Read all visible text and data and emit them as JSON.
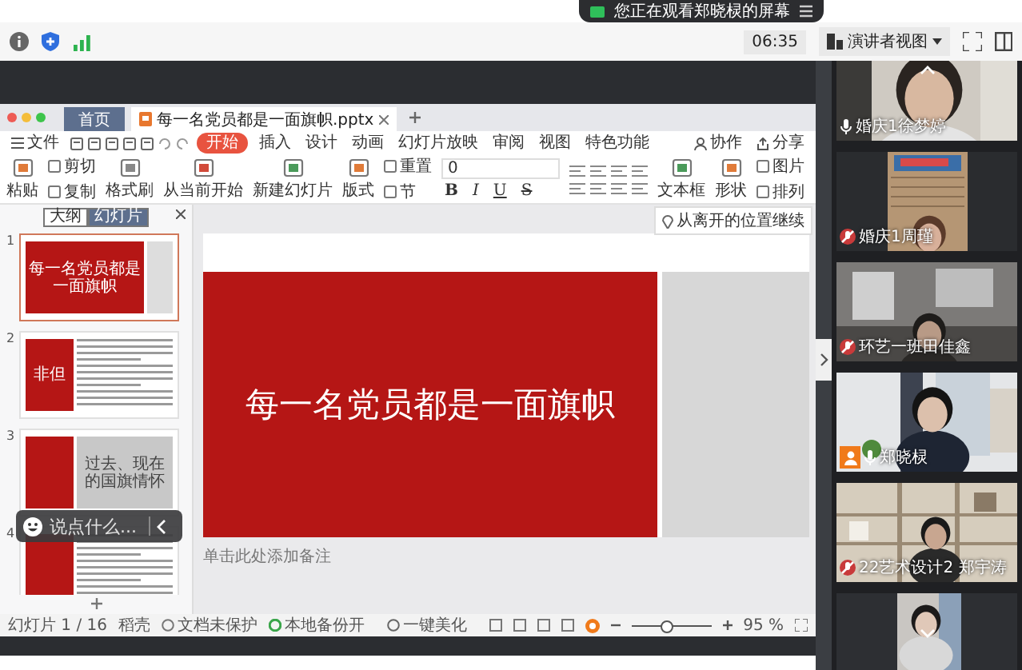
{
  "banner": {
    "text": "您正在观看郑晓棂的屏幕"
  },
  "toolbar": {
    "time": "06:35",
    "view_menu": "演讲者视图"
  },
  "presentation": {
    "tabs": [
      {
        "label": "首页",
        "kind": "home",
        "selected": false
      },
      {
        "label": "每一名党员都是一面旗帜.pptx",
        "kind": "document",
        "selected": true
      }
    ],
    "file_menu": "文件",
    "menu": [
      {
        "label": "开始",
        "selected": true
      },
      {
        "label": "插入",
        "selected": false
      },
      {
        "label": "设计",
        "selected": false
      },
      {
        "label": "动画",
        "selected": false
      },
      {
        "label": "幻灯片放映",
        "selected": false
      },
      {
        "label": "审阅",
        "selected": false
      },
      {
        "label": "视图",
        "selected": false
      },
      {
        "label": "特色功能",
        "selected": false
      }
    ],
    "share_actions": [
      "协作",
      "分享"
    ],
    "ribbon": [
      {
        "kind": "large",
        "label": "粘贴"
      },
      {
        "kind": "stack",
        "items": [
          "剪切",
          "复制"
        ]
      },
      {
        "kind": "large",
        "label": "格式刷"
      },
      {
        "kind": "large",
        "label": "从当前开始"
      },
      {
        "kind": "large",
        "label": "新建幻灯片"
      },
      {
        "kind": "large",
        "label": "版式"
      },
      {
        "kind": "stack",
        "items": [
          "重置",
          "节"
        ]
      },
      {
        "kind": "font",
        "size": "0",
        "buttons": [
          "B",
          "I",
          "U",
          "S"
        ]
      },
      {
        "kind": "paragraph"
      },
      {
        "kind": "large",
        "label": "文本框"
      },
      {
        "kind": "large",
        "label": "形状"
      },
      {
        "kind": "stack",
        "items": [
          "图片",
          "排列"
        ]
      }
    ],
    "panel_tabs": [
      {
        "label": "大纲",
        "selected": false
      },
      {
        "label": "幻灯片",
        "selected": true
      }
    ],
    "slides": [
      {
        "number": "1",
        "kind": "title",
        "title": "每一名党员都是一面旗帜",
        "selected": true
      },
      {
        "number": "2",
        "kind": "text",
        "title": "非但",
        "selected": false
      },
      {
        "number": "3",
        "kind": "split",
        "title": "过去、现在的国旗情怀",
        "selected": false
      },
      {
        "number": "4",
        "kind": "text",
        "selected": false
      }
    ],
    "slide_title": "每一名党员都是一面旗帜",
    "resume_hint": "从离开的位置继续",
    "notes": {
      "placeholder": "单击此处添加备注"
    },
    "status_bar": {
      "slide_count": "幻灯片 1 / 16",
      "theme": "稻壳",
      "protection": "文档未保护",
      "backup": "本地备份开",
      "beautify": "一键美化",
      "zoom": "95 %",
      "level": 0.45
    }
  },
  "chat_input": {
    "placeholder": "说点什么..."
  },
  "participants": [
    {
      "kind": "camera",
      "name": "婚庆1徐梦婷",
      "muted": false,
      "host": false
    },
    {
      "kind": "camera",
      "name": "婚庆1周瑾",
      "muted": true,
      "host": false
    },
    {
      "kind": "camera",
      "name": "环艺一班田佳鑫",
      "muted": true,
      "host": false
    },
    {
      "kind": "camera",
      "name": "郑晓棂",
      "muted": false,
      "host": true
    },
    {
      "kind": "camera",
      "name": "22艺术设计2 郑宇涛",
      "muted": true,
      "host": false
    },
    {
      "kind": "picture"
    }
  ]
}
